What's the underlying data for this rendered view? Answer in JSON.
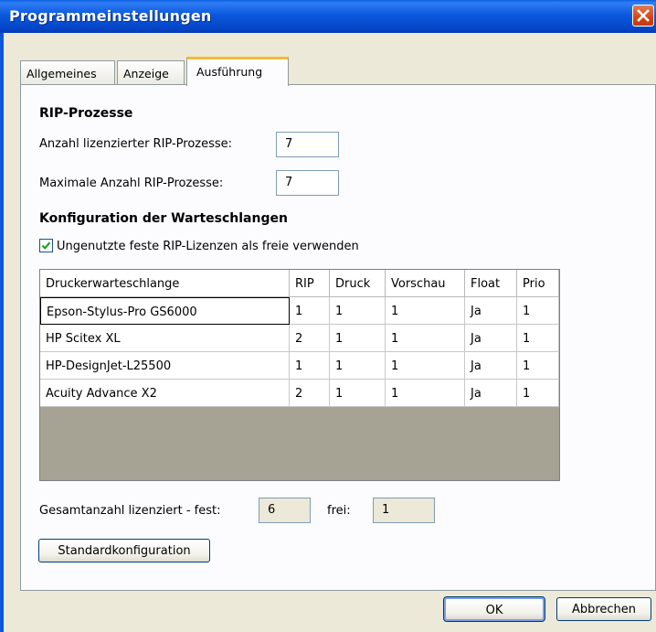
{
  "window": {
    "title": "Programmeinstellungen"
  },
  "tabs": [
    {
      "label": "Allgemeines",
      "active": false
    },
    {
      "label": "Anzeige",
      "active": false
    },
    {
      "label": "Ausführung",
      "active": true
    }
  ],
  "rip": {
    "heading": "RIP-Prozesse",
    "licensed_label": "Anzahl lizenzierter RIP-Prozesse:",
    "licensed_value": "7",
    "max_label": "Maximale Anzahl RIP-Prozesse:",
    "max_value": "7"
  },
  "queues": {
    "heading": "Konfiguration der Warteschlangen",
    "checkbox_label": "Ungenutzte feste RIP-Lizenzen als freie verwenden",
    "checkbox_checked": true,
    "columns": [
      "Druckerwarteschlange",
      "RIP",
      "Druck",
      "Vorschau",
      "Float",
      "Prio"
    ],
    "rows": [
      [
        "Epson-Stylus-Pro GS6000",
        "1",
        "1",
        "1",
        "Ja",
        "1"
      ],
      [
        "HP Scitex XL",
        "2",
        "1",
        "1",
        "Ja",
        "1"
      ],
      [
        "HP-DesignJet-L25500",
        "1",
        "1",
        "1",
        "Ja",
        "1"
      ],
      [
        "Acuity Advance X2",
        "2",
        "1",
        "1",
        "Ja",
        "1"
      ]
    ]
  },
  "totals": {
    "label": "Gesamtanzahl lizenziert - fest:",
    "fixed_value": "6",
    "free_label": "frei:",
    "free_value": "1"
  },
  "buttons": {
    "standard": "Standardkonfiguration",
    "ok": "OK",
    "cancel": "Abbrechen"
  },
  "colors": {
    "titlebar": "#0b58dd",
    "dialog_bg": "#ece9d8",
    "tab_highlight": "#f6b93c",
    "checkbox_check": "#21a121"
  }
}
